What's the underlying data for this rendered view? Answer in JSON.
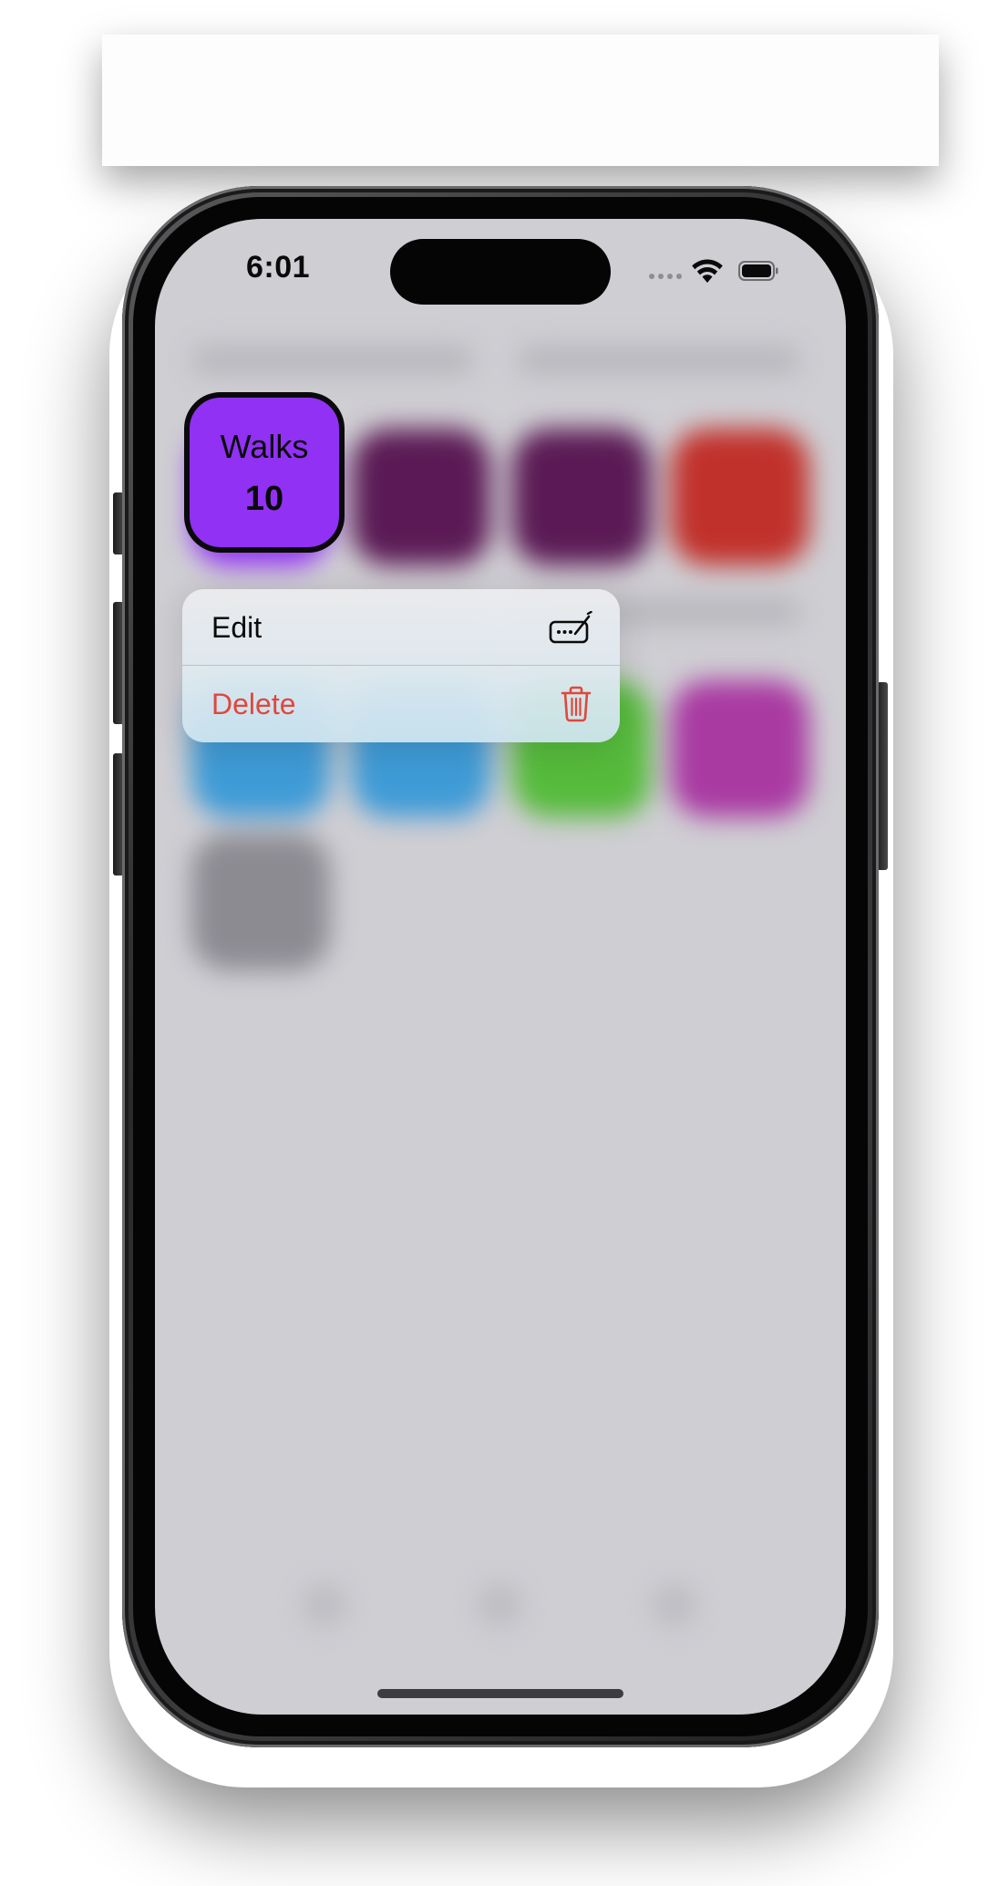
{
  "status_bar": {
    "time": "6:01",
    "icons": [
      "signal-dots-icon",
      "wifi-icon",
      "battery-icon"
    ]
  },
  "focused_tile": {
    "title": "Walks",
    "count": "10",
    "color": "#9131f4"
  },
  "context_menu": {
    "items": [
      {
        "label": "Edit",
        "icon": "edit-keyboard-icon",
        "color": "#0a0a0a"
      },
      {
        "label": "Delete",
        "icon": "trash-icon",
        "color": "#e0473d"
      }
    ]
  },
  "background_tiles": {
    "colors": [
      "#5b1a55",
      "#5b1a55",
      "#c1312b",
      "#3f9bd6",
      "#3f9bd6",
      "#56bb3c",
      "#a93aa2",
      "#8c8b92"
    ]
  }
}
